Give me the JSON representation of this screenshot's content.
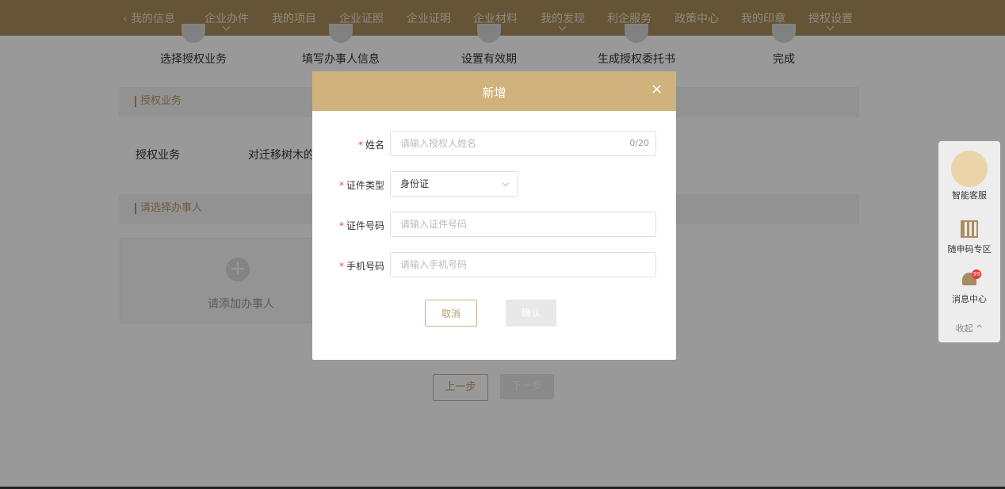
{
  "nav": {
    "back_label": "我的信息",
    "items": [
      {
        "label": "企业办件",
        "has_caret": true
      },
      {
        "label": "我的项目",
        "has_caret": false
      },
      {
        "label": "企业证照",
        "has_caret": false
      },
      {
        "label": "企业证明",
        "has_caret": false
      },
      {
        "label": "企业材料",
        "has_caret": false
      },
      {
        "label": "我的发现",
        "has_caret": true
      },
      {
        "label": "利企服务",
        "has_caret": false
      },
      {
        "label": "政策中心",
        "has_caret": false
      },
      {
        "label": "我的印章",
        "has_caret": false
      },
      {
        "label": "授权设置",
        "has_caret": true
      }
    ]
  },
  "steps": [
    {
      "label": "选择授权业务"
    },
    {
      "label": "填写办事人信息"
    },
    {
      "label": "设置有效期"
    },
    {
      "label": "生成授权委托书"
    },
    {
      "label": "完成"
    }
  ],
  "auth_section": {
    "title": "授权业务",
    "biz_label": "授权业务",
    "biz_value": "对迁移树木的"
  },
  "agent_section": {
    "title": "请选择办事人",
    "add_text": "请添加办事人"
  },
  "footer_buttons": {
    "prev": "上一步",
    "next": "下一步"
  },
  "side_panel": {
    "service": "智能客服",
    "qr_zone": "随申码专区",
    "message_center": "消息中心",
    "message_badge": "99",
    "collapse": "收起 ^"
  },
  "dialog": {
    "title": "新增",
    "close_glyph": "×",
    "name": {
      "label": "姓名",
      "placeholder": "请输入授权人姓名",
      "counter": "0/20"
    },
    "id_type": {
      "label": "证件类型",
      "value": "身份证"
    },
    "id_number": {
      "label": "证件号码",
      "placeholder": "请输入证件号码"
    },
    "phone": {
      "label": "手机号码",
      "placeholder": "请输入手机号码"
    },
    "cancel": "取消",
    "confirm": "确认"
  }
}
